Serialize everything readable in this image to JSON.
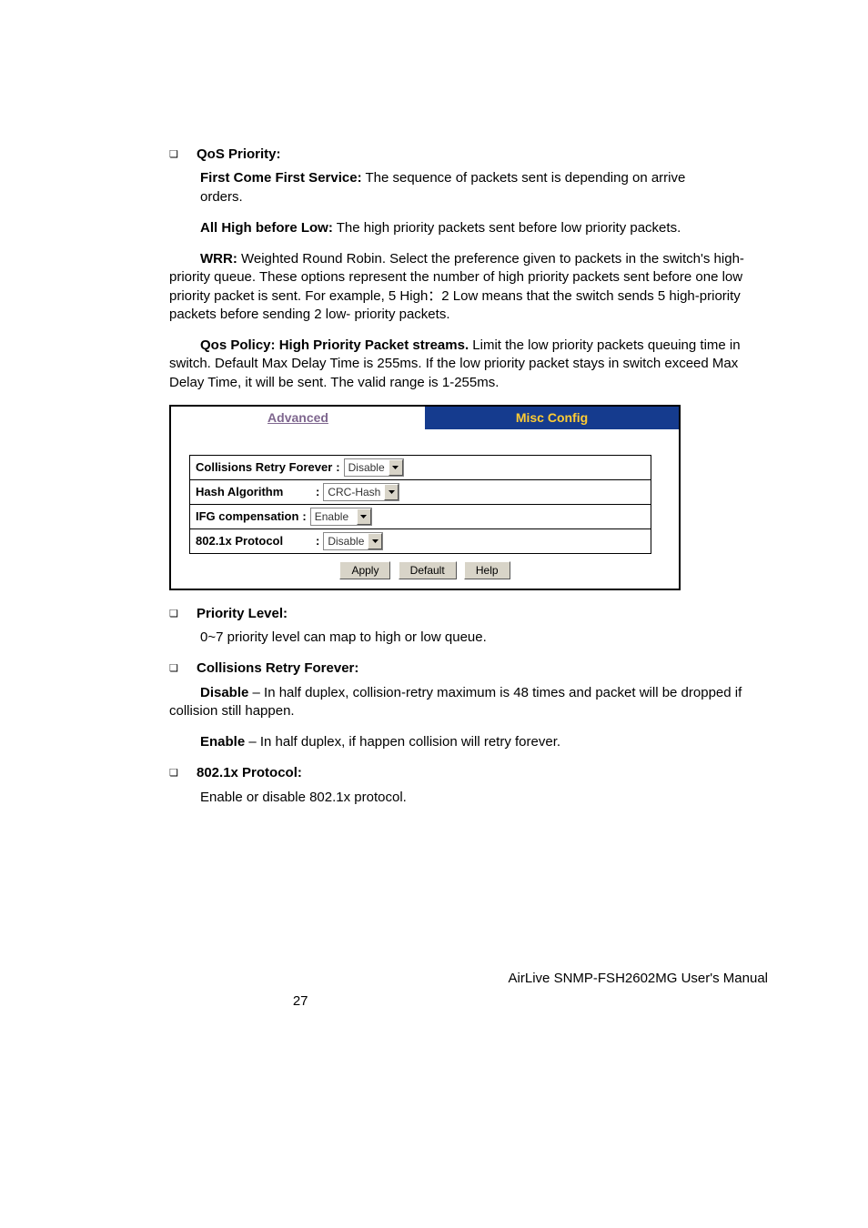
{
  "sections": {
    "qos_priority": {
      "title": "QoS Priority:",
      "fcfs_label": "First Come First Service:",
      "fcfs_text_1": " The sequence of packets sent is depending on arrive",
      "fcfs_text_2": "orders.",
      "all_high_label": "All High before Low:",
      "all_high_text": " The high priority packets sent before low priority packets.",
      "wrr_label": "WRR:",
      "wrr_text": " Weighted Round Robin. Select the preference given to packets in the switch's high-priority queue. These options represent the number of high priority packets sent before one low priority packet is sent. For example, 5 High：2 Low means that the switch sends 5 high-priority packets before sending 2 low- priority packets.",
      "qos_delay_label": "Qos Policy: High Priority Packet streams.",
      "qos_delay_text": " Limit the low priority packets queuing time in switch. Default Max Delay Time is 255ms. If the low priority packet stays in switch exceed Max Delay Time, it will be sent. The valid range is 1-255ms."
    },
    "priority_level": {
      "title": "Priority Level:",
      "text": "0~7 priority level can map to high or low queue."
    },
    "collisions": {
      "title": "Collisions Retry Forever:",
      "disable_label": "Disable",
      "disable_text": " – In half duplex, collision-retry maximum is 48 times and packet will be dropped if collision still happen.",
      "enable_label": "Enable",
      "enable_text": " – In half duplex, if happen collision will retry forever."
    },
    "dot1x": {
      "title": "802.1x Protocol:",
      "text": "Enable or disable 802.1x protocol."
    }
  },
  "figure": {
    "tabs": {
      "advanced": "Advanced",
      "misc": "Misc Config"
    },
    "rows": {
      "collisions": {
        "label": "Collisions Retry Forever",
        "value": "Disable"
      },
      "hash": {
        "label": "Hash Algorithm",
        "value": "CRC-Hash"
      },
      "ifg": {
        "label": "IFG compensation",
        "value": "Enable"
      },
      "dot1x": {
        "label": "802.1x Protocol",
        "value": "Disable"
      }
    },
    "buttons": {
      "apply": "Apply",
      "default": "Default",
      "help": "Help"
    }
  },
  "footer": {
    "product": "AirLive SNMP-FSH2602MG User's Manual",
    "page": "27"
  }
}
